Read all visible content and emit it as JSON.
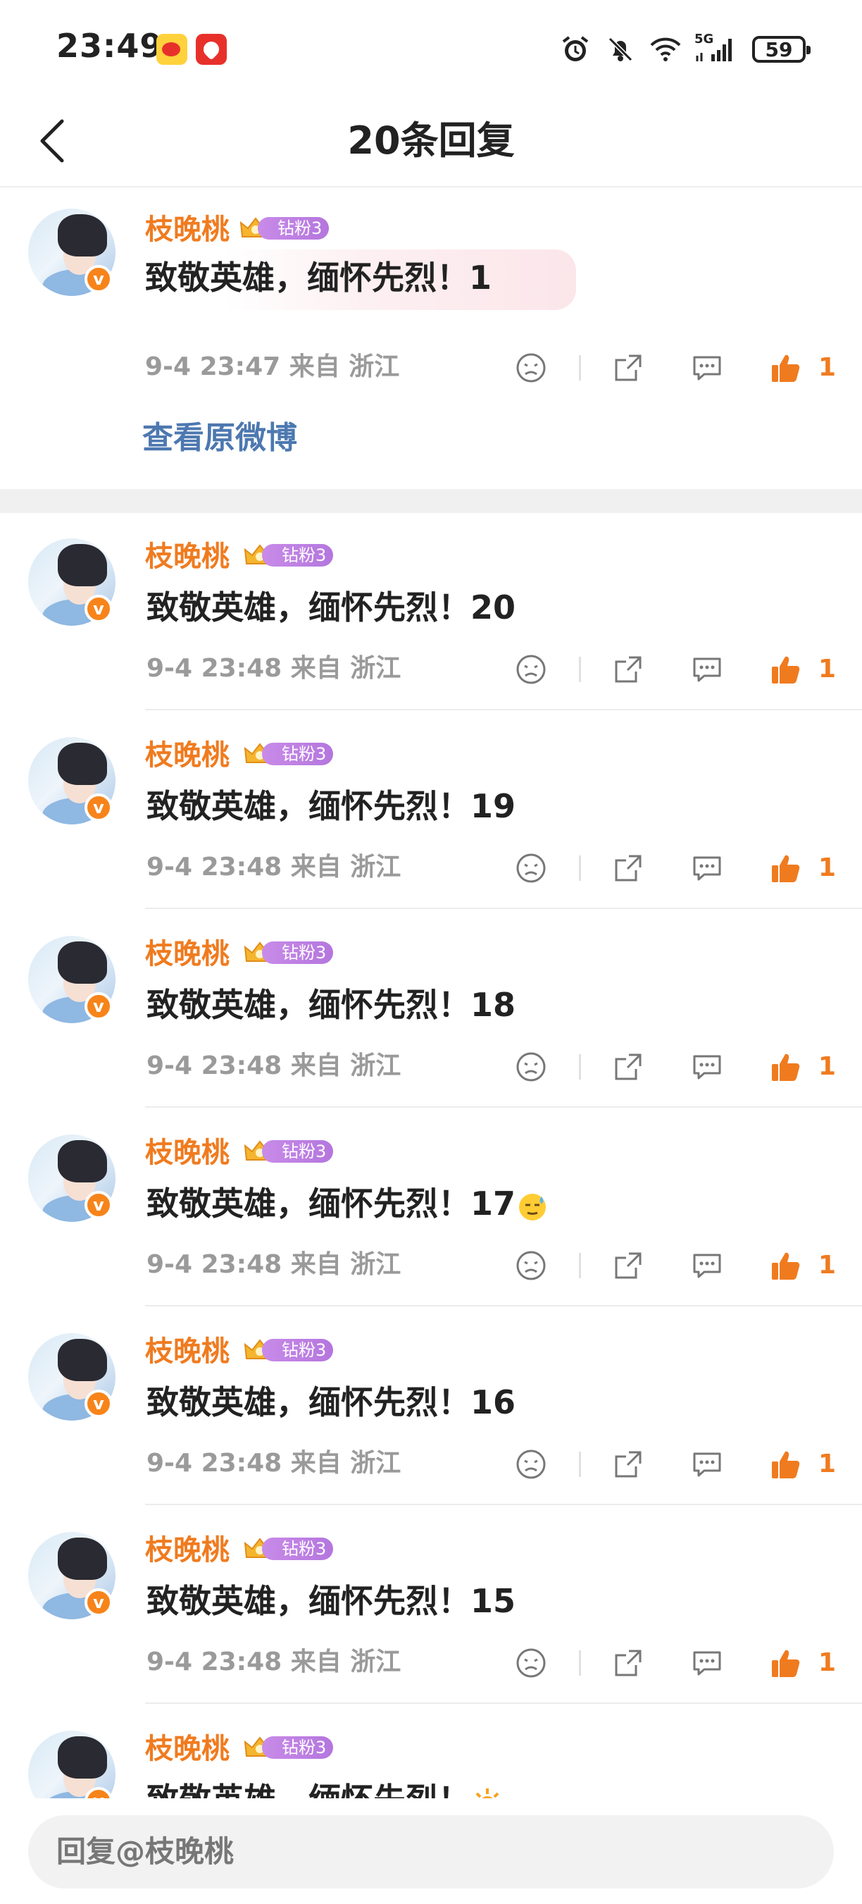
{
  "status_bar": {
    "time": "23:49",
    "battery": "59",
    "network": "5G",
    "icons": [
      "weibo-app-icon",
      "red-app-icon",
      "alarm-icon",
      "mute-bell-icon",
      "wifi-icon",
      "signal-icon",
      "battery-icon"
    ]
  },
  "header": {
    "title": "20条回复",
    "back_icon": "chevron-left-icon"
  },
  "root_comment": {
    "username": "枝晚桃",
    "fan_badge": "钻粉3",
    "text": "致敬英雄，缅怀先烈！1",
    "time": "9-4 23:47",
    "source": "来自 浙江",
    "likes": "1",
    "view_original": "查看原微博"
  },
  "replies": [
    {
      "username": "枝晚桃",
      "fan_badge": "钻粉3",
      "text": "致敬英雄，缅怀先烈！20",
      "emoji": "",
      "time": "9-4 23:48",
      "source": "来自 浙江",
      "likes": "1"
    },
    {
      "username": "枝晚桃",
      "fan_badge": "钻粉3",
      "text": "致敬英雄，缅怀先烈！19",
      "emoji": "",
      "time": "9-4 23:48",
      "source": "来自 浙江",
      "likes": "1"
    },
    {
      "username": "枝晚桃",
      "fan_badge": "钻粉3",
      "text": "致敬英雄，缅怀先烈！18",
      "emoji": "",
      "time": "9-4 23:48",
      "source": "来自 浙江",
      "likes": "1"
    },
    {
      "username": "枝晚桃",
      "fan_badge": "钻粉3",
      "text": "致敬英雄，缅怀先烈！17",
      "emoji": "sweat-smile-emoji",
      "time": "9-4 23:48",
      "source": "来自 浙江",
      "likes": "1"
    },
    {
      "username": "枝晚桃",
      "fan_badge": "钻粉3",
      "text": "致敬英雄，缅怀先烈！16",
      "emoji": "",
      "time": "9-4 23:48",
      "source": "来自 浙江",
      "likes": "1"
    },
    {
      "username": "枝晚桃",
      "fan_badge": "钻粉3",
      "text": "致敬英雄，缅怀先烈！15",
      "emoji": "",
      "time": "9-4 23:48",
      "source": "来自 浙江",
      "likes": "1"
    },
    {
      "username": "枝晚桃",
      "fan_badge": "钻粉3",
      "text": "致敬英雄，缅怀先烈！",
      "emoji": "sun-emoji",
      "time": "",
      "source": "",
      "likes": ""
    }
  ],
  "reply_input": {
    "placeholder": "回复@枝晚桃"
  },
  "colors": {
    "username": "#f07b1f",
    "like": "#f07b1f",
    "link": "#4d78b0",
    "fan_badge": "#b476de",
    "meta": "#9a9a9a"
  }
}
